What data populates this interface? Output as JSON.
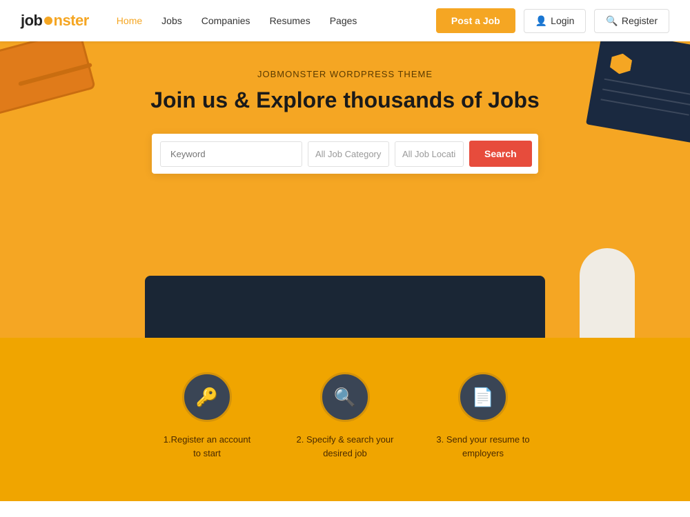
{
  "navbar": {
    "logo_job": "job",
    "logo_monster": "monster",
    "links": [
      {
        "label": "Home",
        "active": true
      },
      {
        "label": "Jobs",
        "active": false
      },
      {
        "label": "Companies",
        "active": false
      },
      {
        "label": "Resumes",
        "active": false
      },
      {
        "label": "Pages",
        "active": false
      }
    ],
    "post_job_label": "Post a Job",
    "login_label": "Login",
    "register_label": "Register"
  },
  "hero": {
    "subtitle": "JobMonster WordPress Theme",
    "title": "Join us & Explore thousands of Jobs",
    "search": {
      "keyword_placeholder": "Keyword",
      "category_placeholder": "All Job Category",
      "location_placeholder": "All Job Locati",
      "search_btn": "Search"
    }
  },
  "steps": [
    {
      "number": "1",
      "label": "1.Register an account\nto start",
      "icon": "🔑"
    },
    {
      "number": "2",
      "label": "2. Specify & search your\ndesired job",
      "icon": "🔍"
    },
    {
      "number": "3",
      "label": "3. Send your resume to\nemployers",
      "icon": "📄"
    }
  ]
}
